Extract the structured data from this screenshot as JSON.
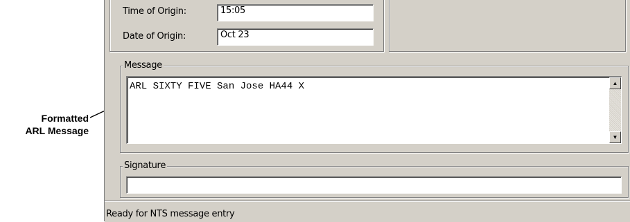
{
  "callout": {
    "line1": "Formatted",
    "line2": "ARL Message"
  },
  "origin": {
    "time_label": "Time of Origin:",
    "time_value": "15:05",
    "date_label": "Date of Origin:",
    "date_value": "Oct 23"
  },
  "message": {
    "group_title": "Message",
    "text": "ARL SIXTY FIVE San Jose HA44 X",
    "scroll_up_icon": "up-arrow",
    "scroll_down_icon": "down-arrow"
  },
  "signature": {
    "group_title": "Signature",
    "value": ""
  },
  "status_bar": {
    "text": "Ready for NTS message entry"
  }
}
